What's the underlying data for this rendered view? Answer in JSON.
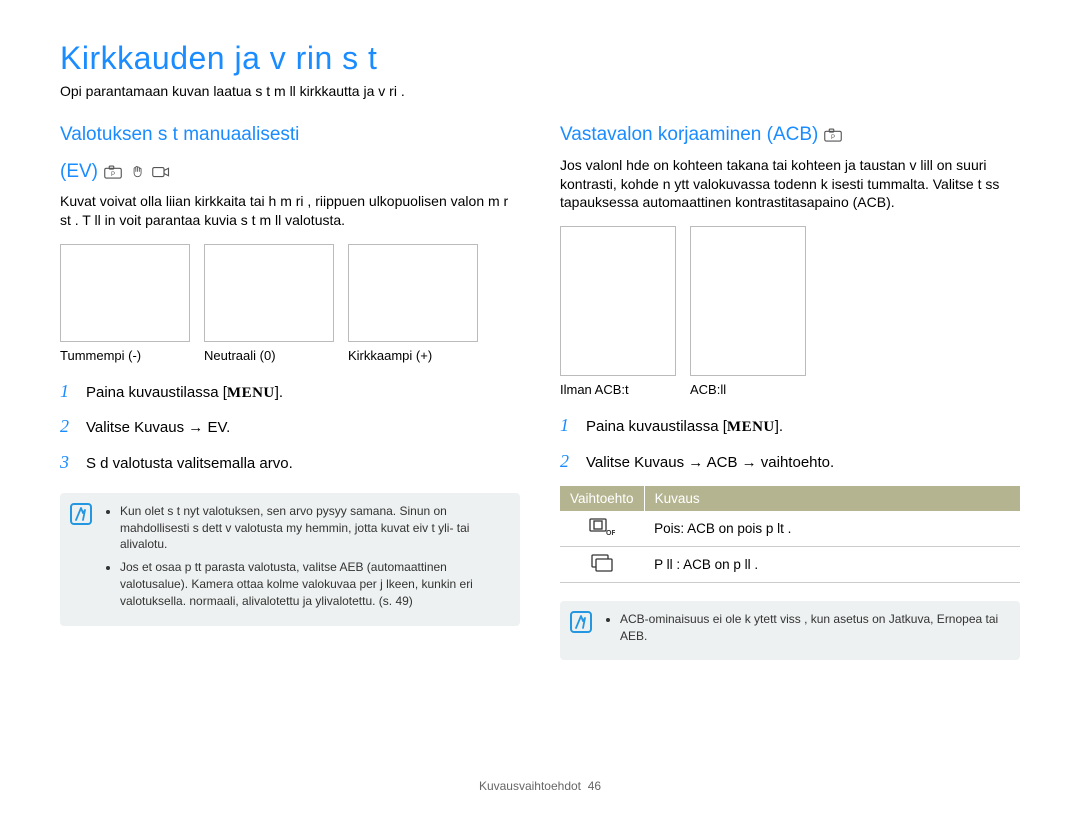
{
  "page": {
    "title": "Kirkkauden ja v rin s   t",
    "intro": "Opi parantamaan kuvan laatua s t m ll  kirkkautta ja v ri ."
  },
  "left": {
    "title_line1": "Valotuksen s t  manuaalisesti",
    "title_line2": "(EV)",
    "desc": "Kuvat voivat olla liian kirkkaita tai h m ri , riippuen ulkopuolisen valon m r st . T ll in voit parantaa kuvia s t m ll  valotusta.",
    "thumbs": [
      {
        "caption": "Tummempi (-)"
      },
      {
        "caption": "Neutraali (0)"
      },
      {
        "caption": "Kirkkaampi (+)"
      }
    ],
    "steps": {
      "s1_a": "Paina kuvaustilassa [",
      "s1_menu": "MENU",
      "s1_b": "].",
      "s2": "Valitse Kuvaus → EV.",
      "s3": "S d  valotusta valitsemalla arvo."
    },
    "notes": [
      "Kun olet s t nyt valotuksen, sen arvo pysyy samana. Sinun on mahdollisesti s dett v  valotusta my hemmin, jotta kuvat eiv t yli- tai alivalotu.",
      "Jos et osaa p tt   parasta valotusta, valitse AEB (automaattinen valotusalue). Kamera ottaa kolme valokuvaa per j lkeen, kunkin eri valotuksella. normaali, alivalotettu ja ylivalotettu. (s. 49)"
    ]
  },
  "right": {
    "title": "Vastavalon korjaaminen (ACB)",
    "desc": "Jos valonl hde on kohteen takana tai kohteen ja taustan v lill  on suuri kontrasti, kohde n ytt   valokuvassa todenn k isesti tummalta. Valitse t ss  tapauksessa automaattinen kontrastitasapaino (ACB).",
    "thumbs": [
      {
        "caption": "Ilman ACB:t"
      },
      {
        "caption": "ACB:ll"
      }
    ],
    "steps": {
      "s1_a": "Paina kuvaustilassa [",
      "s1_menu": "MENU",
      "s1_b": "].",
      "s2": "Valitse Kuvaus → ACB → vaihtoehto."
    },
    "table": {
      "h1": "Vaihtoehto",
      "h2": "Kuvaus",
      "r1": "Pois: ACB on pois p lt .",
      "r2": "P ll : ACB on p ll ."
    },
    "notes": [
      "ACB-ominaisuus ei ole k ytett viss , kun asetus on Jatkuva, Ernopea tai AEB."
    ]
  },
  "footer": {
    "section": "Kuvausvaihtoehdot",
    "page_num": "46"
  }
}
